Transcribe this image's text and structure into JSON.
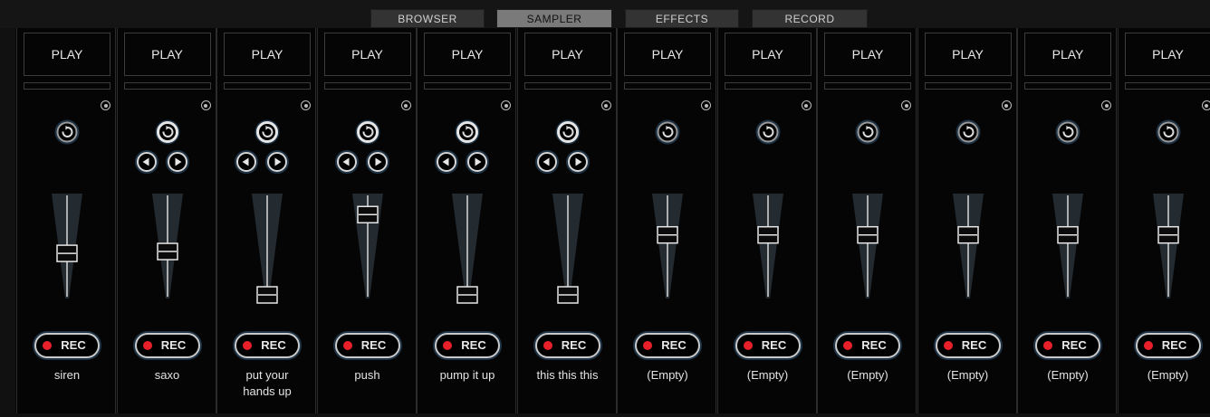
{
  "tabs": [
    {
      "label": "BROWSER",
      "active": false
    },
    {
      "label": "SAMPLER",
      "active": true
    },
    {
      "label": "EFFECTS",
      "active": false
    },
    {
      "label": "RECORD",
      "active": false
    }
  ],
  "colors": {
    "background": "#111111",
    "slot": "#050505",
    "accent_glow": "#1e3345",
    "rec_red": "#e8202a",
    "text": "#e8e8e8"
  },
  "slots": [
    {
      "play_label": "PLAY",
      "rec_label": "REC",
      "name": "siren",
      "volume": 0.45,
      "has_arrows": false,
      "loop_active": false
    },
    {
      "play_label": "PLAY",
      "rec_label": "REC",
      "name": "saxo",
      "volume": 0.47,
      "has_arrows": true,
      "loop_active": true
    },
    {
      "play_label": "PLAY",
      "rec_label": "REC",
      "name": "put your hands up",
      "volume": 0.0,
      "has_arrows": true,
      "loop_active": true
    },
    {
      "play_label": "PLAY",
      "rec_label": "REC",
      "name": "push",
      "volume": 0.87,
      "has_arrows": true,
      "loop_active": true
    },
    {
      "play_label": "PLAY",
      "rec_label": "REC",
      "name": "pump it up",
      "volume": 0.0,
      "has_arrows": true,
      "loop_active": true
    },
    {
      "play_label": "PLAY",
      "rec_label": "REC",
      "name": "this this this",
      "volume": 0.0,
      "has_arrows": true,
      "loop_active": true
    },
    {
      "play_label": "PLAY",
      "rec_label": "REC",
      "name": "(Empty)",
      "volume": 0.65,
      "has_arrows": false,
      "loop_active": false
    },
    {
      "play_label": "PLAY",
      "rec_label": "REC",
      "name": "(Empty)",
      "volume": 0.65,
      "has_arrows": false,
      "loop_active": false
    },
    {
      "play_label": "PLAY",
      "rec_label": "REC",
      "name": "(Empty)",
      "volume": 0.65,
      "has_arrows": false,
      "loop_active": false
    },
    {
      "play_label": "PLAY",
      "rec_label": "REC",
      "name": "(Empty)",
      "volume": 0.65,
      "has_arrows": false,
      "loop_active": false
    },
    {
      "play_label": "PLAY",
      "rec_label": "REC",
      "name": "(Empty)",
      "volume": 0.65,
      "has_arrows": false,
      "loop_active": false
    },
    {
      "play_label": "PLAY",
      "rec_label": "REC",
      "name": "(Empty)",
      "volume": 0.65,
      "has_arrows": false,
      "loop_active": false
    }
  ]
}
